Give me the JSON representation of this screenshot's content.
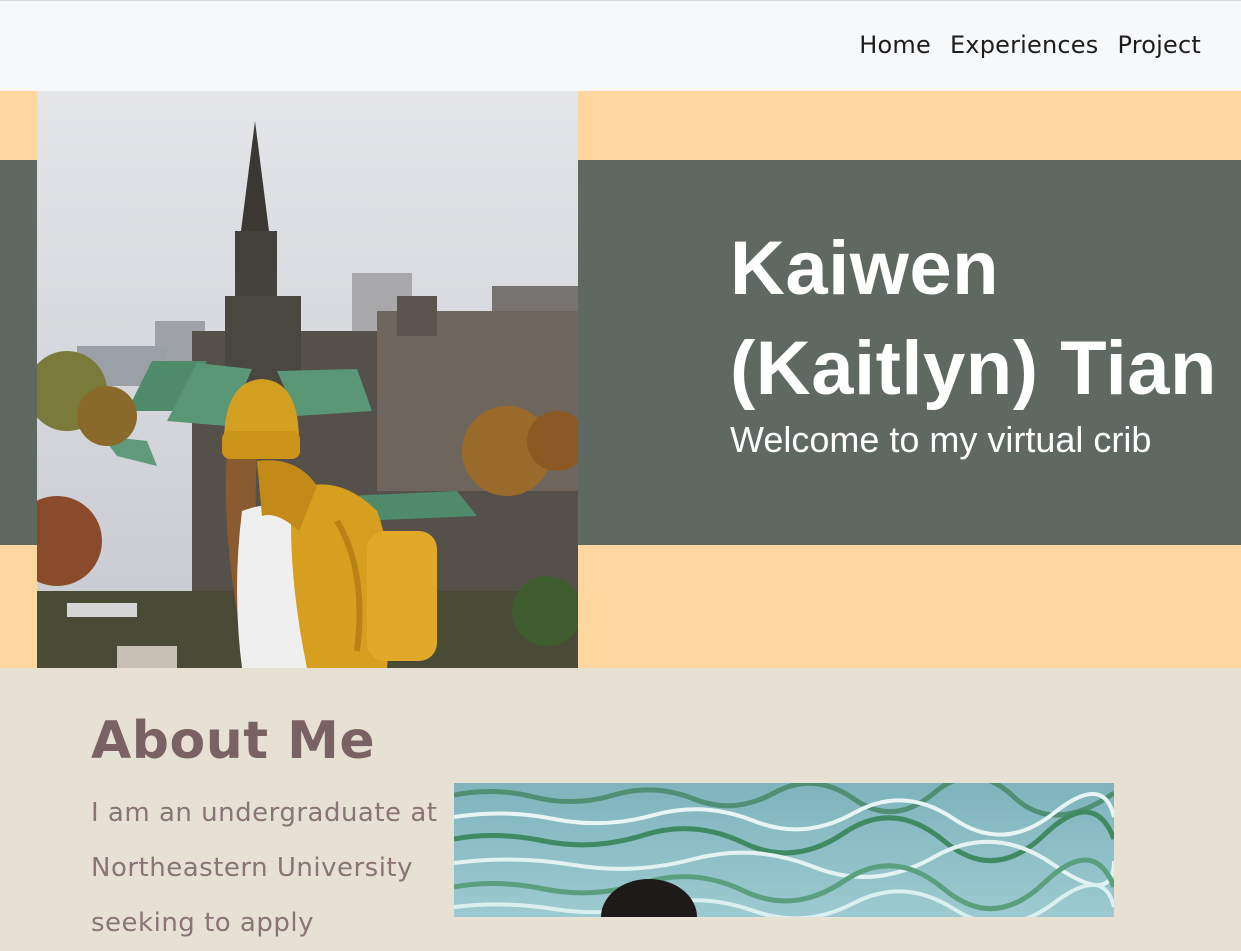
{
  "nav": {
    "items": [
      {
        "label": "Home"
      },
      {
        "label": "Experiences"
      },
      {
        "label": "Project"
      }
    ]
  },
  "hero": {
    "name_line1": "Kaiwen",
    "name_line2": "(Kaitlyn) Tian",
    "subtitle": "Welcome to my virtual crib",
    "colors": {
      "background": "#fed7a0",
      "band": "#5f6962",
      "text": "#ffffff"
    }
  },
  "about": {
    "heading": "About Me",
    "text": "I am an undergraduate at Northeastern University seeking to apply",
    "colors": {
      "background": "#e7e1d4",
      "heading": "#7a6264",
      "text": "#8a7475"
    }
  }
}
